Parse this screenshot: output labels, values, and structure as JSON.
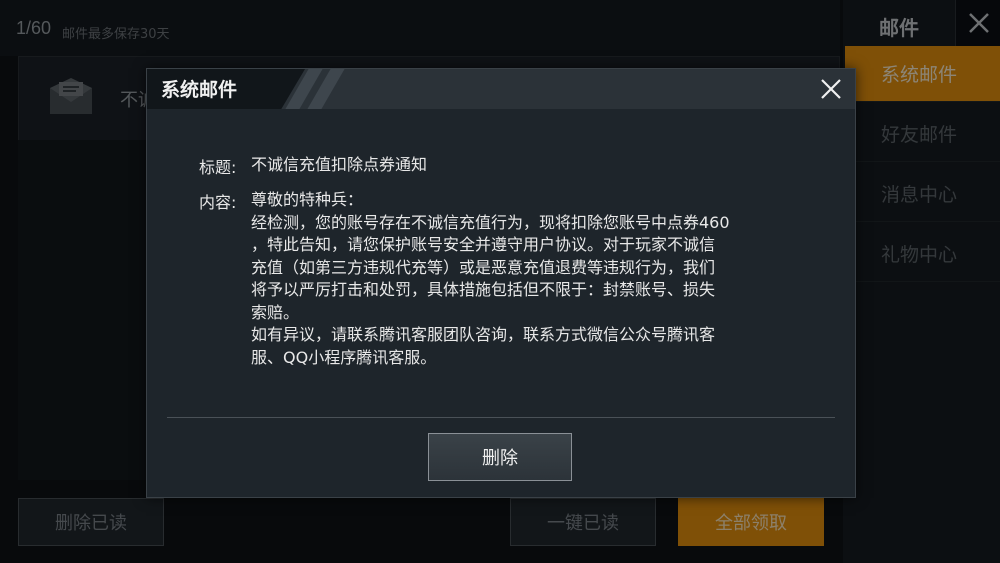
{
  "background": {
    "counter": "1/60",
    "storage_note": "邮件最多保存30天",
    "list_item_preview": "不诚",
    "delete_read_label": "删除已读",
    "mark_all_read_label": "一键已读",
    "claim_all_label": "全部领取"
  },
  "sidebar": {
    "title": "邮件",
    "items": [
      {
        "label": "系统邮件",
        "active": true
      },
      {
        "label": "好友邮件",
        "active": false
      },
      {
        "label": "消息中心",
        "active": false
      },
      {
        "label": "礼物中心",
        "active": false
      }
    ]
  },
  "modal": {
    "title": "系统邮件",
    "subject_label": "标题:",
    "subject": "不诚信充值扣除点券通知",
    "content_label": "内容:",
    "content_lines": [
      "尊敬的特种兵：",
      "经检测，您的账号存在不诚信充值行为，现将扣除您账号中点券460",
      "，特此告知，请您保护账号安全并遵守用户协议。对于玩家不诚信",
      "充值（如第三方违规代充等）或是恶意充值退费等违规行为，我们",
      "将予以严厉打击和处罚，具体措施包括但不限于：封禁账号、损失",
      "索赔。",
      "如有异议，请联系腾讯客服团队咨询，联系方式微信公众号腾讯客",
      "服、QQ小程序腾讯客服。"
    ],
    "delete_label": "删除"
  },
  "colors": {
    "accent": "#e8920e",
    "modal_bg": "#1e252b"
  }
}
